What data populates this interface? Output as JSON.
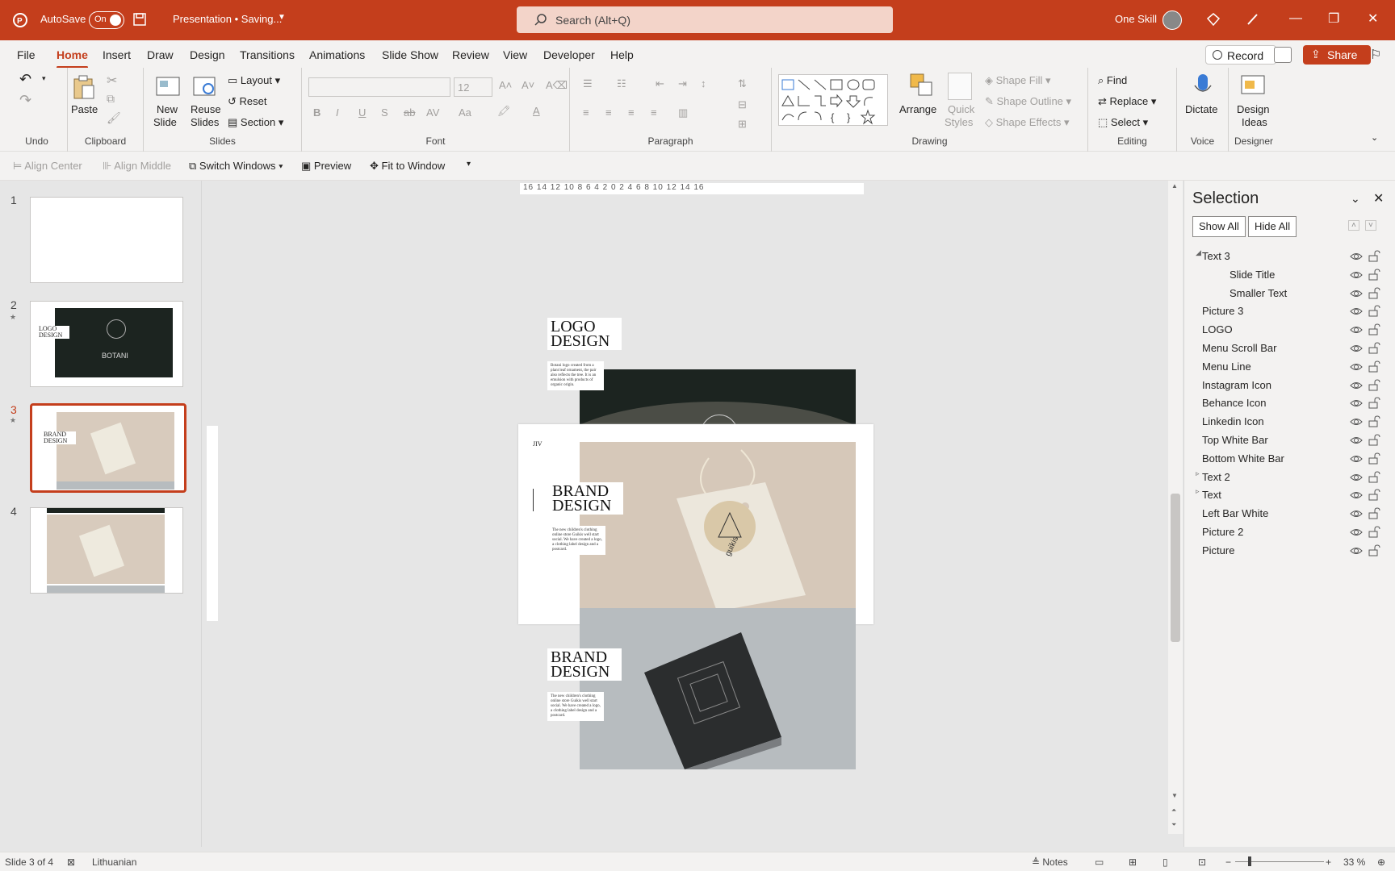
{
  "titlebar": {
    "autosave_label": "AutoSave",
    "autosave_state": "On",
    "doc_title": "Presentation • Saving...",
    "search_placeholder": "Search (Alt+Q)",
    "user_name": "One Skill"
  },
  "menu": {
    "tabs": [
      "File",
      "Home",
      "Insert",
      "Draw",
      "Design",
      "Transitions",
      "Animations",
      "Slide Show",
      "Review",
      "View",
      "Developer",
      "Help"
    ],
    "active": "Home",
    "record": "Record",
    "share": "Share"
  },
  "ribbon": {
    "undo_group": "Undo",
    "clipboard": {
      "paste": "Paste",
      "group": "Clipboard"
    },
    "slides": {
      "new_slide": "New Slide",
      "new_slide_line1": "New",
      "new_slide_line2": "Slide",
      "reuse_line1": "Reuse",
      "reuse_line2": "Slides",
      "layout": "Layout",
      "reset": "Reset",
      "section": "Section",
      "group": "Slides"
    },
    "font": {
      "size": "12",
      "group": "Font"
    },
    "paragraph": {
      "group": "Paragraph"
    },
    "drawing": {
      "arrange": "Arrange",
      "quick_line1": "Quick",
      "quick_line2": "Styles",
      "shape_fill": "Shape Fill",
      "shape_outline": "Shape Outline",
      "shape_effects": "Shape Effects",
      "group": "Drawing"
    },
    "editing": {
      "find": "Find",
      "replace": "Replace",
      "select": "Select",
      "group": "Editing"
    },
    "voice": {
      "dictate": "Dictate",
      "group": "Voice"
    },
    "designer": {
      "line1": "Design",
      "line2": "Ideas",
      "group": "Designer"
    }
  },
  "qat": {
    "align_center": "Align Center",
    "align_middle": "Align Middle",
    "switch_windows": "Switch Windows",
    "preview": "Preview",
    "fit": "Fit to Window"
  },
  "thumbnails": {
    "numbers": [
      "1",
      "2",
      "3",
      "4"
    ],
    "slide2_title": "LOGO DESIGN",
    "slide2_brand": "BOTANI",
    "slide3_title": "BRAND DESIGN"
  },
  "slide": {
    "top_title": "LOGO DESIGN",
    "top_body": "Botani logo created from a plant leaf ornament, the pair also reflects the tree. It is an emulsion with products of organic origin.",
    "mid_logo": "JIV",
    "mid_title": "BRAND DESIGN",
    "mid_body": "The new children's clothing online store Guikis well start social. We have created a logo, a clothing label design and a postcard.",
    "bottom_title": "BRAND DESIGN",
    "bottom_body": "The new children's clothing online store Guikis well start social. We have created a logo, a clothing label design and a postcard.",
    "tag_brand": "guikis",
    "h_ruler": "16 14 12 10 8 6 4 2 0 2 4 6 8 10 12 14 16"
  },
  "selection": {
    "title": "Selection",
    "show_all": "Show All",
    "hide_all": "Hide All",
    "items": [
      "Text 3",
      "Slide Title",
      "Smaller Text",
      "Picture 3",
      "LOGO",
      "Menu Scroll Bar",
      "Menu Line",
      "Instagram Icon",
      "Behance Icon",
      "Linkedin Icon",
      "Top White Bar",
      "Bottom White Bar",
      "Text 2",
      "Text",
      "Left Bar White",
      "Picture 2",
      "Picture"
    ]
  },
  "status": {
    "slide_of": "Slide 3 of 4",
    "language": "Lithuanian",
    "notes": "Notes",
    "zoom": "33 %"
  },
  "colors": {
    "accent": "#c43e1c",
    "ribbon_bg": "#f3f2f1",
    "canvas_bg": "#e6e6e6"
  }
}
